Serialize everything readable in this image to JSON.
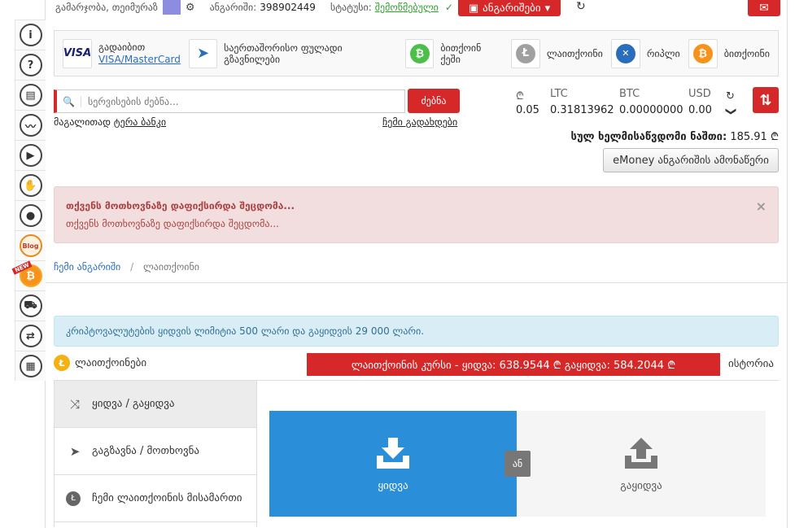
{
  "rail": [
    {
      "name": "info-icon",
      "glyph": "i"
    },
    {
      "name": "help-icon",
      "glyph": "?"
    },
    {
      "name": "calculator-icon",
      "glyph": "▤"
    },
    {
      "name": "chart-icon",
      "glyph": "〰"
    },
    {
      "name": "play-icon",
      "glyph": "▶"
    },
    {
      "name": "handshake-icon",
      "glyph": "✋"
    },
    {
      "name": "user-icon",
      "glyph": "●"
    },
    {
      "name": "blog-icon",
      "glyph": "Blog"
    },
    {
      "name": "bitcoin-icon",
      "glyph": "₿"
    },
    {
      "name": "cart-icon",
      "glyph": "⛟"
    },
    {
      "name": "exchange-icon",
      "glyph": "⇄"
    },
    {
      "name": "calendar-icon",
      "glyph": "▦"
    }
  ],
  "rail_new_badge": "NEW",
  "topbar": {
    "greeting": "გამარჯობა, თეიმურაზ",
    "account_label": "ანგარიში:",
    "account_number": "398902449",
    "status_label": "სტატუსი:",
    "status_value": "შემოწმებული",
    "status_check": "✓",
    "gear": "⚙",
    "accounts_button": "ანგარიშები",
    "refresh": "↻",
    "mail": "✉"
  },
  "pay_methods": [
    {
      "line1": "გადაიბით",
      "line2": "VISA/MasterCard",
      "logo": "VISA",
      "color": "#1a1f71"
    },
    {
      "line1": "საერთაშორისო ფულადი გზავნილები",
      "logo": "➤",
      "color": "#2a6ebb"
    },
    {
      "line1": "ბითქოინ ქეში",
      "logo": "₿",
      "color": "#4cbf4b"
    },
    {
      "line1": "ლაითქოინი",
      "logo": "Ł",
      "color": "#a0a0a0"
    },
    {
      "line1": "რიპლი",
      "logo": "✕",
      "color": "#2a6ebb"
    },
    {
      "line1": "ბითქოინი",
      "logo": "₿",
      "color": "#f7931a"
    }
  ],
  "search": {
    "placeholder": "სერვისების ძებნა...",
    "button": "ძებნა",
    "hint_prefix": "მაგალითად",
    "hint_example": "ტერა ბანკი",
    "my_payments": "ჩემი გადახდები"
  },
  "balances": [
    {
      "currency": "₾",
      "amount": "0.05"
    },
    {
      "currency": "LTC",
      "amount": "0.31813962"
    },
    {
      "currency": "BTC",
      "amount": "0.00000000"
    },
    {
      "currency": "USD",
      "amount": "0.00"
    }
  ],
  "balance_controls": {
    "refresh": "↻",
    "expand": "❯"
  },
  "swap": "⇅",
  "total": {
    "label": "სულ ხელმისაწვდომი ნაშთი:",
    "amount": "185.91",
    "currency": "₾"
  },
  "emoney_button": "eMoney ანგარიშის ამონაწერი",
  "alert": {
    "title": "თქვენს მოთხოვნაზე დაფიქსირდა შეცდომა...",
    "text": "თქვენს მოთხოვნაზე დაფიქსირდა შეცდომა...",
    "close": "×"
  },
  "breadcrumb": {
    "root": "ჩემი ანგარიში",
    "current": "ლაითქოინი"
  },
  "info": "კრიპტოვალუტების ყიდვის ლიმიტია 500 ლარი და გაყიდვის 29 000 ლარი.",
  "ltc": {
    "title": "ლაითქოინები",
    "rate_text": "ლაითქოინის კურსი - ყიდვა: 638.9544 ₾  გაყიდვა: 584.2044 ₾",
    "history": "ისტორია"
  },
  "side_menu": [
    {
      "icon": "⤨",
      "label": "ყიდვა / გაყიდვა",
      "active": true
    },
    {
      "icon": "➤",
      "label": "გაგზავნა / მოთხოვნა",
      "active": false
    },
    {
      "icon": "Ł",
      "label": "ჩემი ლაითქოინის მისამართი",
      "active": false
    }
  ],
  "buy_sell": {
    "buy": "ყიდვა",
    "or": "ან",
    "sell": "გაყიდვა"
  },
  "colors": {
    "accent": "#d62828",
    "buy": "#2b8ed8",
    "link": "#2a6ebb"
  }
}
